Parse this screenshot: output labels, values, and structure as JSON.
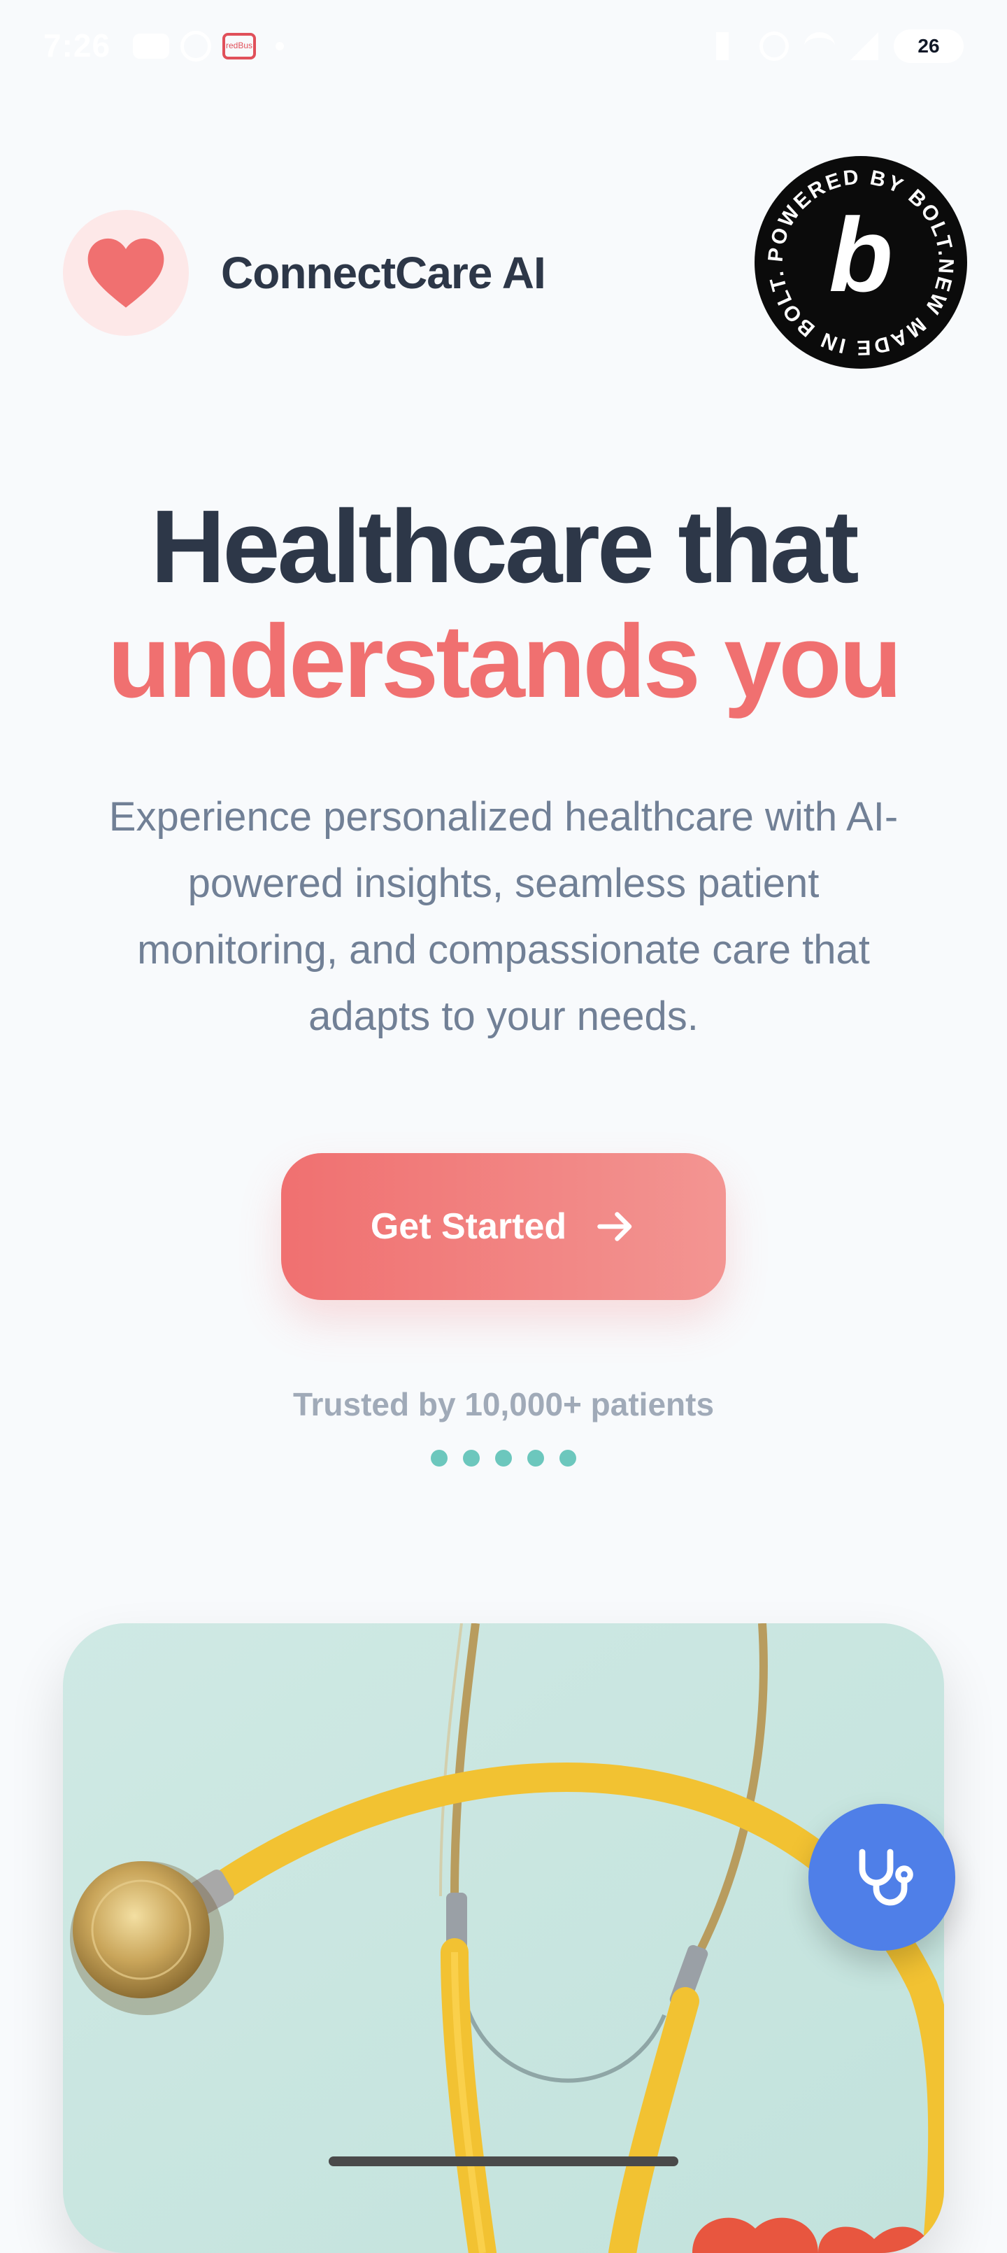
{
  "status_bar": {
    "time": "7:26",
    "left_icons": [
      "message-icon",
      "whatsapp-icon",
      "redbus-icon",
      "dot-icon"
    ],
    "redbus_label": "redBus",
    "right_icons": [
      "mute-icon",
      "hotspot-icon",
      "wifi-icon",
      "signal-icon",
      "battery-icon"
    ],
    "battery": "26"
  },
  "header": {
    "brand_name": "ConnectCare AI",
    "logo_icon": "heart-icon",
    "badge_text": "POWERED BY BOLT.NEW MADE IN BOLT.NEW",
    "badge_letter": "b"
  },
  "hero": {
    "title_line1": "Healthcare that",
    "title_line2": "understands you",
    "subtitle": "Experience personalized healthcare with AI-powered insights, seamless patient monitoring, and compassionate care that adapts to your needs."
  },
  "cta": {
    "label": "Get Started",
    "icon": "arrow-right-icon"
  },
  "trust": {
    "text": "Trusted by 10,000+ patients",
    "dot_count": 5
  },
  "fab": {
    "icon": "stethoscope-icon"
  },
  "colors": {
    "accent": "#f07070",
    "text_dark": "#2d3748",
    "text_muted": "#718096",
    "teal_dot": "#6cc7bd",
    "fab_blue": "#4f7fe8",
    "background": "#f8fafc"
  }
}
